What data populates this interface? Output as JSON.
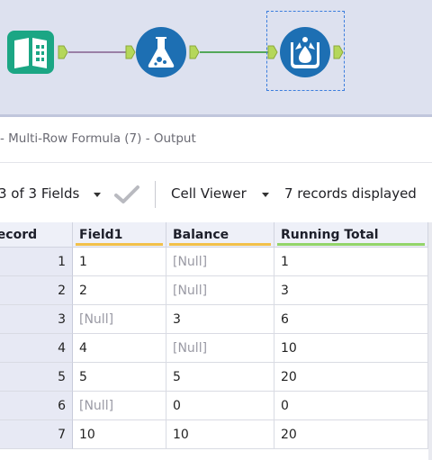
{
  "panel": {
    "title": "- Multi-Row Formula (7) - Output"
  },
  "toolbar": {
    "fields_label": "3 of 3 Fields",
    "viewer_label": "Cell Viewer",
    "records_label": "7 records displayed"
  },
  "grid": {
    "headers": {
      "record": "Record",
      "field1": "Field1",
      "balance": "Balance",
      "running_total": "Running Total"
    },
    "rows": [
      {
        "n": "1",
        "field1": "1",
        "balance": "[Null]",
        "running_total": "1"
      },
      {
        "n": "2",
        "field1": "2",
        "balance": "[Null]",
        "running_total": "3"
      },
      {
        "n": "3",
        "field1": "[Null]",
        "balance": "3",
        "running_total": "6"
      },
      {
        "n": "4",
        "field1": "4",
        "balance": "[Null]",
        "running_total": "10"
      },
      {
        "n": "5",
        "field1": "5",
        "balance": "5",
        "running_total": "20"
      },
      {
        "n": "6",
        "field1": "[Null]",
        "balance": "0",
        "running_total": "0"
      },
      {
        "n": "7",
        "field1": "10",
        "balance": "10",
        "running_total": "20"
      }
    ]
  },
  "workflow": {
    "tools": [
      {
        "icon": "input-book-icon",
        "color": "#1ba684"
      },
      {
        "icon": "formula-flask-icon",
        "color": "#1d6fb3"
      },
      {
        "icon": "multi-row-formula-icon",
        "color": "#1d6fb3"
      }
    ],
    "connector_colors": [
      "#9a7fa6",
      "#53a859"
    ],
    "anchor_color": "#b5d75a",
    "selection_color": "#3b7ddd"
  }
}
